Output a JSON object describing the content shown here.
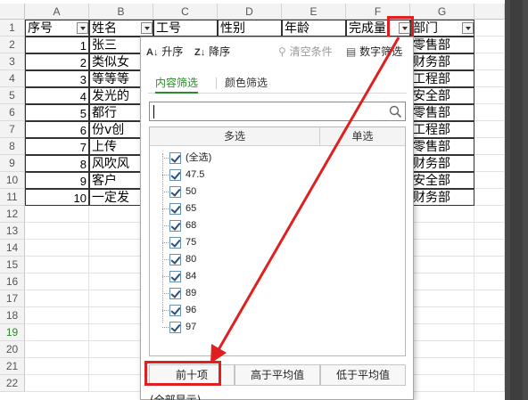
{
  "columns": [
    "A",
    "B",
    "C",
    "D",
    "E",
    "F",
    "G"
  ],
  "row_numbers": [
    "1",
    "2",
    "3",
    "4",
    "5",
    "6",
    "7",
    "8",
    "9",
    "10",
    "11",
    "12",
    "13",
    "14",
    "15",
    "16",
    "17",
    "18",
    "19",
    "20",
    "21",
    "22"
  ],
  "selected_row": "19",
  "headers": {
    "seq": "序号",
    "name": "姓名",
    "id": "工号",
    "gender": "性别",
    "age": "年龄",
    "completion": "完成量",
    "dept": "部门"
  },
  "rows": [
    {
      "seq": "1",
      "name": "张三",
      "dept": "零售部"
    },
    {
      "seq": "2",
      "name": "类似女",
      "dept": "财务部"
    },
    {
      "seq": "3",
      "name": "等等等",
      "dept": "工程部"
    },
    {
      "seq": "4",
      "name": "发光的",
      "dept": "安全部"
    },
    {
      "seq": "5",
      "name": "都行",
      "dept": "零售部"
    },
    {
      "seq": "6",
      "name": "份v创",
      "dept": "工程部"
    },
    {
      "seq": "7",
      "name": "上传",
      "dept": "零售部"
    },
    {
      "seq": "8",
      "name": "风吹风",
      "dept": "财务部"
    },
    {
      "seq": "9",
      "name": "客户",
      "dept": "安全部"
    },
    {
      "seq": "10",
      "name": "一定发",
      "dept": "财务部"
    }
  ],
  "popup": {
    "sort_asc": "升序",
    "sort_desc": "降序",
    "clear": "清空条件",
    "number_filter": "数字筛选",
    "tab_content": "内容筛选",
    "tab_color": "颜色筛选",
    "search_value": "",
    "col_multi": "多选",
    "col_single": "单选",
    "items": [
      "(全选)",
      "47.5",
      "50",
      "65",
      "68",
      "75",
      "80",
      "84",
      "89",
      "96",
      "97"
    ],
    "btn_top10": "前十项",
    "btn_above": "高于平均值",
    "btn_below": "低于平均值",
    "footer": "(全部显示)"
  },
  "colors": {
    "accent": "#2b8a2b",
    "highlight": "#e02020"
  }
}
